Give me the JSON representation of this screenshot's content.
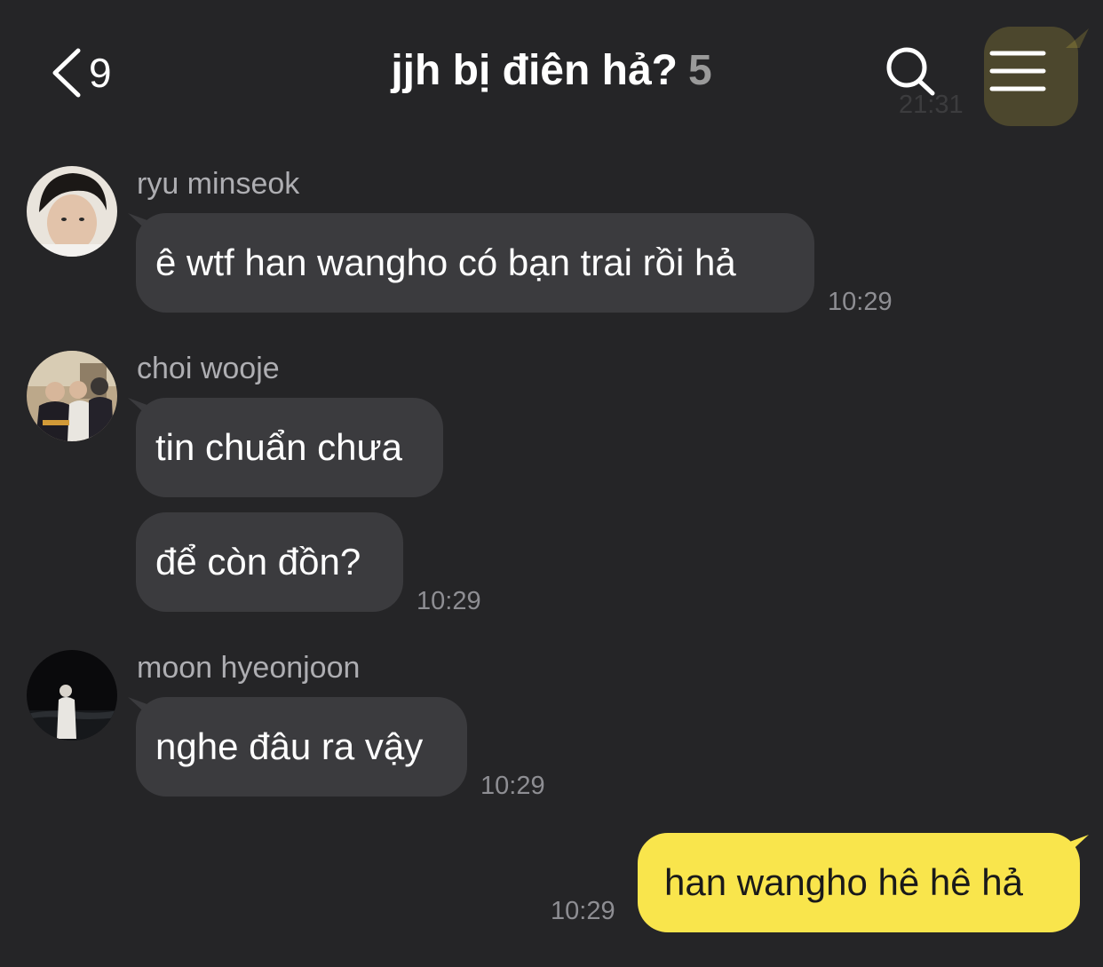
{
  "header": {
    "back_count": "9",
    "title": "jjh bị điên hả?",
    "member_count": "5",
    "background_time": "21:31"
  },
  "colors": {
    "background": "#252527",
    "incoming_bubble": "#3b3b3e",
    "outgoing_bubble": "#f9e54c",
    "secondary_text": "#8e8e93"
  },
  "messages": [
    {
      "sender": "ryu minseok",
      "bubbles": [
        "ê wtf han wangho có bạn trai rồi hả"
      ],
      "time": "10:29"
    },
    {
      "sender": "choi wooje",
      "bubbles": [
        "tin chuẩn chưa",
        "để còn đồn?"
      ],
      "time": "10:29"
    },
    {
      "sender": "moon hyeonjoon",
      "bubbles": [
        "nghe đâu ra vậy"
      ],
      "time": "10:29"
    },
    {
      "sender": "me",
      "bubbles": [
        "han wangho hê hê hả"
      ],
      "time": "10:29"
    }
  ]
}
